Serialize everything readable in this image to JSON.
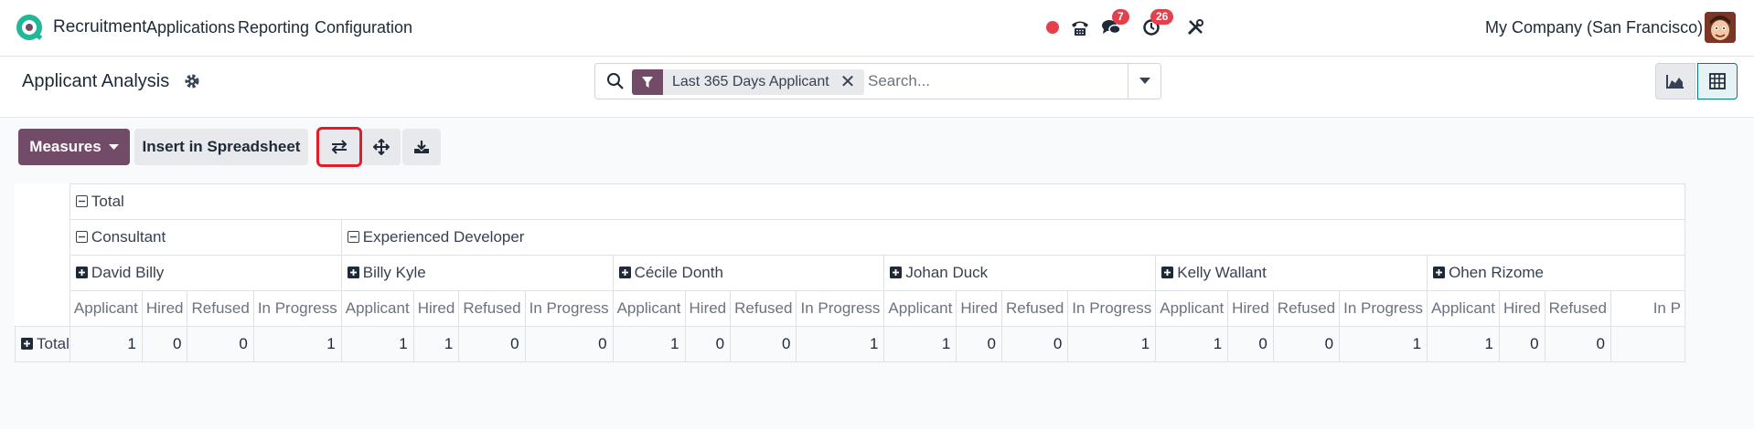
{
  "nav": {
    "app_name": "Recruitment",
    "menu": [
      "Applications",
      "Reporting",
      "Configuration"
    ],
    "chat_badge": "7",
    "activity_badge": "26",
    "company": "My Company (San Francisco)"
  },
  "control": {
    "title": "Applicant Analysis",
    "facet_value": "Last 365 Days Applicant",
    "search_placeholder": "Search..."
  },
  "buttons": {
    "measures": "Measures",
    "insert": "Insert in Spreadsheet"
  },
  "pivot": {
    "total_label": "Total",
    "groups": [
      {
        "label": "Consultant",
        "people": [
          "David Billy"
        ]
      },
      {
        "label": "Experienced Developer",
        "people": [
          "Billy Kyle",
          "Cécile Donth",
          "Johan Duck",
          "Kelly Wallant",
          "Ohen Rizome"
        ]
      }
    ],
    "people": [
      "David Billy",
      "Billy Kyle",
      "Cécile Donth",
      "Johan Duck",
      "Kelly Wallant",
      "Ohen Rizome"
    ],
    "measures": [
      "Applicant",
      "Hired",
      "Refused",
      "In Progress"
    ],
    "last_measure_truncated": "In P",
    "row_label": "Total",
    "values": [
      [
        1,
        0,
        0,
        1
      ],
      [
        1,
        1,
        0,
        0
      ],
      [
        1,
        0,
        0,
        1
      ],
      [
        1,
        0,
        0,
        1
      ],
      [
        1,
        0,
        0,
        1
      ],
      [
        1,
        0,
        0
      ]
    ]
  },
  "colors": {
    "brand": "#714b67",
    "accent": "#017e84",
    "badge": "#e2414b",
    "highlight": "#e11d2a"
  }
}
